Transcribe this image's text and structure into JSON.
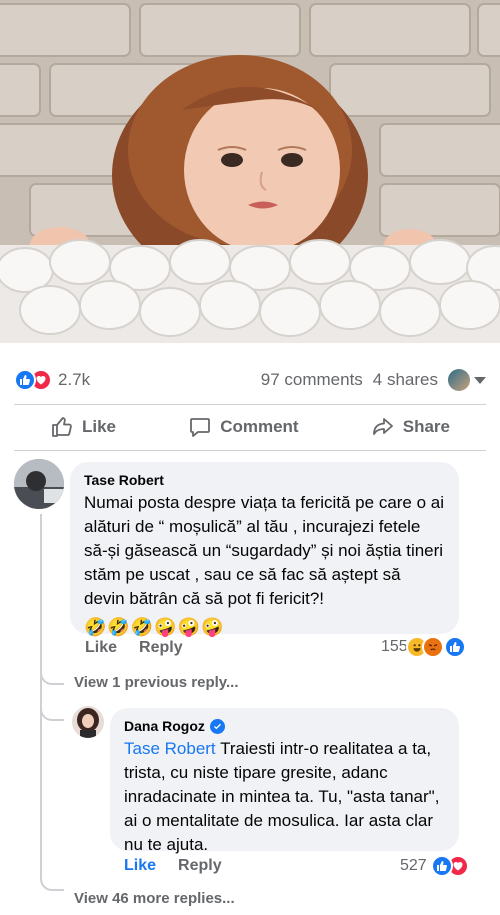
{
  "post": {
    "reaction_count": "2.7k",
    "comments_count": "97 comments",
    "shares_count": "4 shares"
  },
  "actions": {
    "like": "Like",
    "comment": "Comment",
    "share": "Share"
  },
  "comment1": {
    "author": "Tase Robert",
    "text": "Numai posta despre viața ta fericită pe care o ai alături de “ moșulică” al tău , incurajezi fetele să-și găsească un “sugardady” și noi ăștia tineri stăm pe uscat , sau ce să fac să aștept să devin bătrân că să pot fi fericit?!",
    "emojis": "🤣🤣🤣🤪🤪🤪",
    "like_label": "Like",
    "reply_label": "Reply",
    "reaction_count": "155"
  },
  "view_previous": "View 1 previous reply...",
  "reply1": {
    "author": "Dana Rogoz",
    "mention": "Tase Robert",
    "text": " Traiesti intr-o realitatea a ta, trista, cu niste tipare gresite, adanc inradacinate in mintea ta. Tu, \"asta tanar\", ai o mentalitate de mosulica. Iar asta clar nu te ajuta.",
    "like_label": "Like",
    "reply_label": "Reply",
    "reaction_count": "527"
  },
  "view_more": "View 46 more replies...",
  "colors": {
    "accent": "#1877f2",
    "love": "#f02849",
    "muted_text": "#65676b",
    "bubble_bg": "#f0f2f5"
  },
  "icons": [
    "like-icon",
    "love-icon",
    "haha-icon",
    "angry-icon",
    "thumb-up-icon",
    "comment-icon",
    "share-icon",
    "verified-icon",
    "caret-down-icon"
  ]
}
